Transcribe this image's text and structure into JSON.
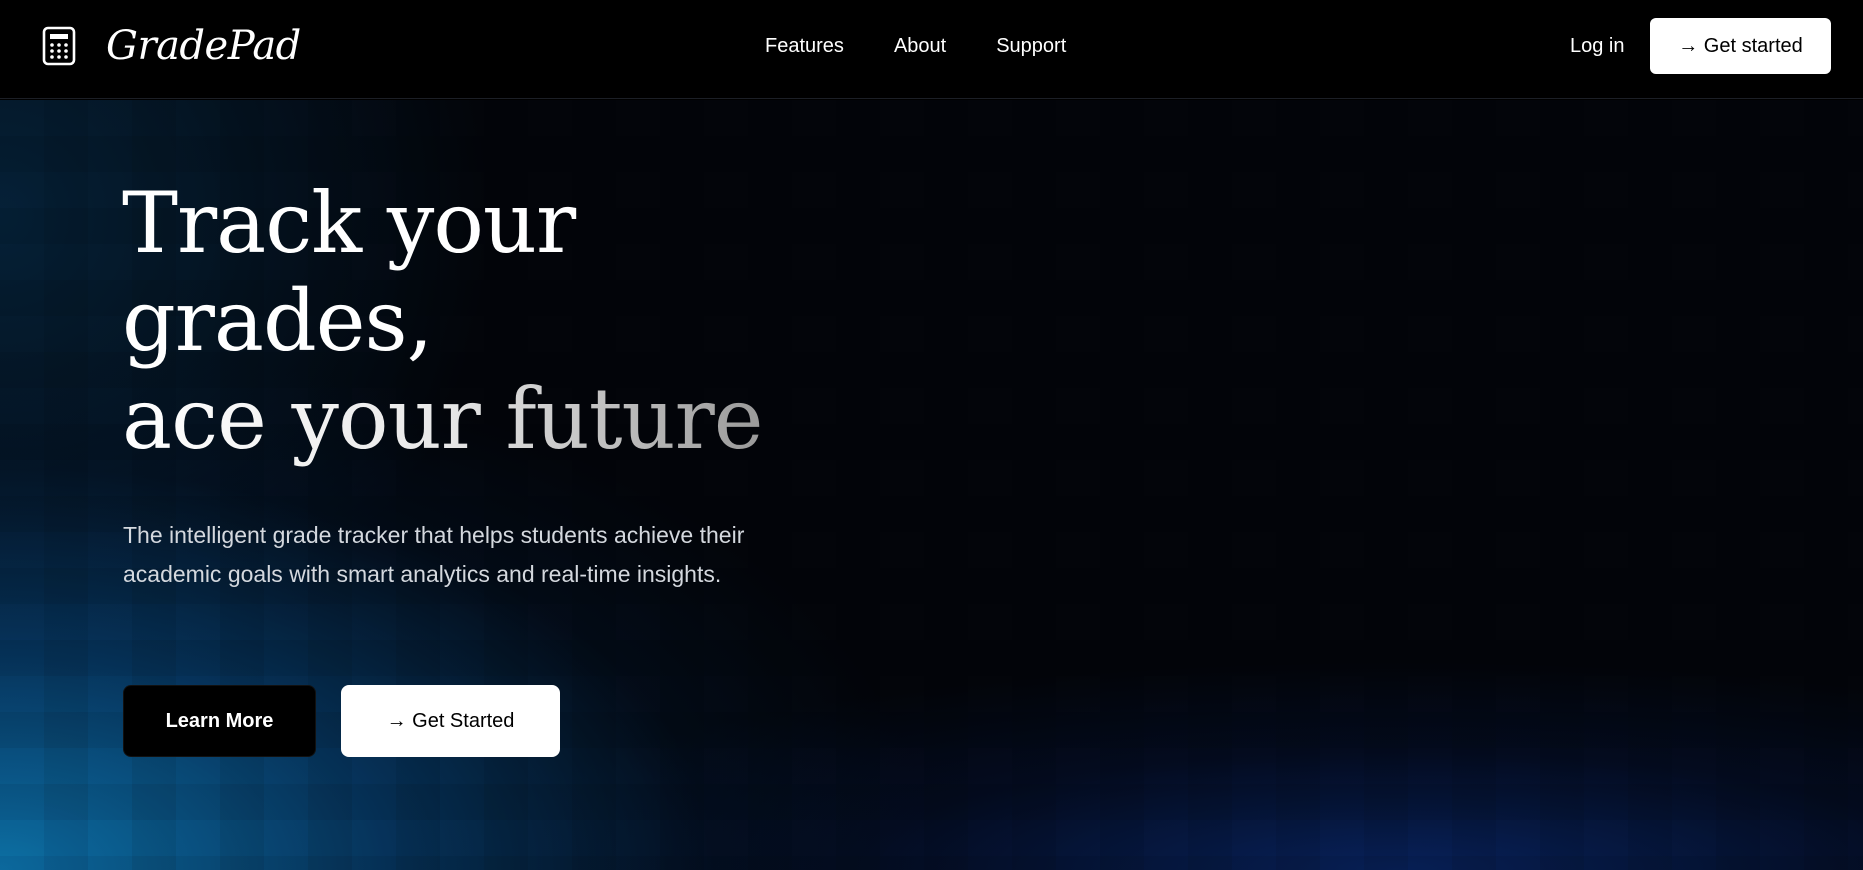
{
  "brand": {
    "name": "GradePad",
    "icon": "calculator-icon"
  },
  "nav": {
    "items": [
      "Features",
      "About",
      "Support"
    ],
    "login_label": "Log in",
    "cta_label": "→ Get started"
  },
  "hero": {
    "headline": [
      "Track your",
      "grades,",
      "ace your future"
    ],
    "subtext": "The intelligent grade tracker that helps students achieve their academic goals with smart analytics and real-time insights.",
    "primary_button": "Learn More",
    "secondary_button": "→ Get Started"
  },
  "colors": {
    "background": "#000000",
    "accent_blue": "#0c6ea5",
    "button_light": "#ffffff"
  }
}
